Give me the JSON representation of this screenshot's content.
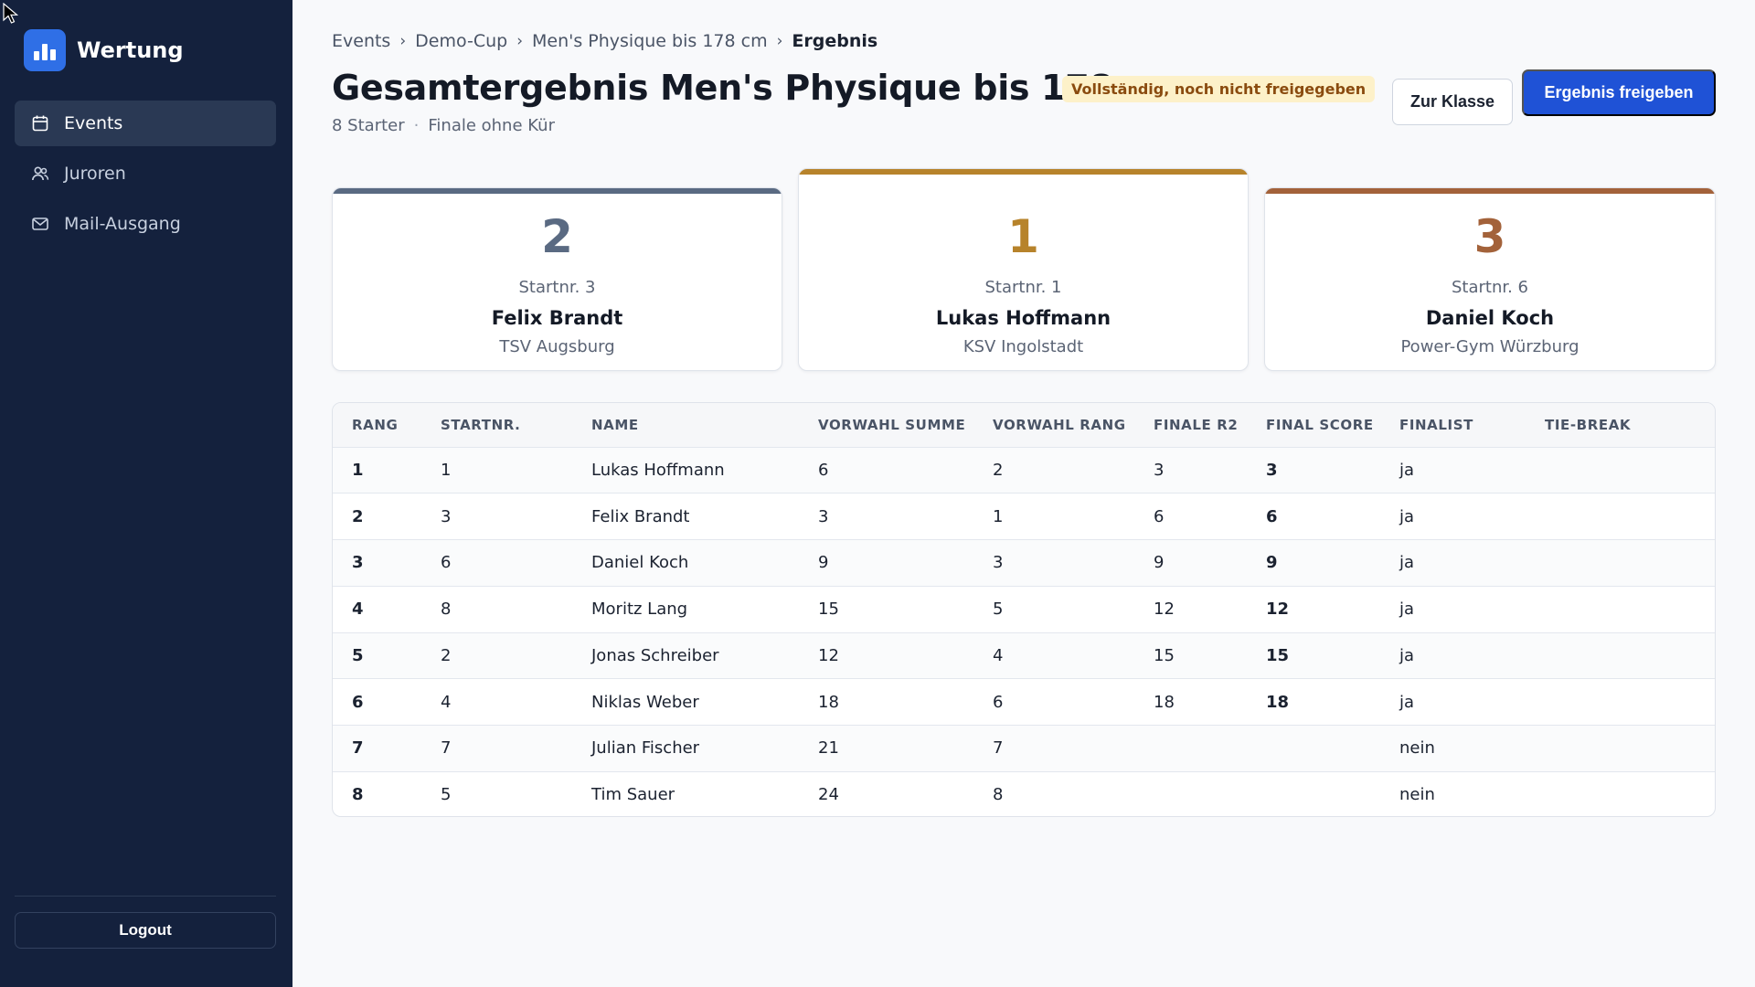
{
  "app": {
    "name": "Wertung",
    "logout_label": "Logout"
  },
  "sidebar": {
    "items": [
      {
        "label": "Events",
        "icon": "calendar-icon",
        "active": true
      },
      {
        "label": "Juroren",
        "icon": "users-icon",
        "active": false
      },
      {
        "label": "Mail-Ausgang",
        "icon": "mail-icon",
        "active": false
      }
    ]
  },
  "breadcrumb": {
    "items": [
      "Events",
      "Demo-Cup",
      "Men's Physique bis 178 cm"
    ],
    "current": "Ergebnis"
  },
  "header": {
    "title": "Gesamtergebnis Men's Physique bis 178 cm",
    "status_badge": "Vollständig, noch nicht freigegeben",
    "starter_count": "8 Starter",
    "mode": "Finale ohne Kür",
    "secondary_button": "Zur Klasse",
    "primary_button": "Ergebnis freigeben"
  },
  "podium": {
    "second": {
      "place": "2",
      "startnr": "Startnr. 3",
      "name": "Felix Brandt",
      "club": "TSV Augsburg",
      "color": "#5a6a82"
    },
    "first": {
      "place": "1",
      "startnr": "Startnr. 1",
      "name": "Lukas Hoffmann",
      "club": "KSV Ingolstadt",
      "color": "#b7832b"
    },
    "third": {
      "place": "3",
      "startnr": "Startnr. 6",
      "name": "Daniel Koch",
      "club": "Power-Gym Würzburg",
      "color": "#a3623a"
    }
  },
  "table": {
    "headers": [
      "RANG",
      "STARTNR.",
      "NAME",
      "VORWAHL SUMME",
      "VORWAHL RANG",
      "FINALE R2",
      "FINAL SCORE",
      "FINALIST",
      "TIE-BREAK"
    ],
    "rows": [
      [
        "1",
        "1",
        "Lukas Hoffmann",
        "6",
        "2",
        "3",
        "3",
        "ja",
        ""
      ],
      [
        "2",
        "3",
        "Felix Brandt",
        "3",
        "1",
        "6",
        "6",
        "ja",
        ""
      ],
      [
        "3",
        "6",
        "Daniel Koch",
        "9",
        "3",
        "9",
        "9",
        "ja",
        ""
      ],
      [
        "4",
        "8",
        "Moritz Lang",
        "15",
        "5",
        "12",
        "12",
        "ja",
        ""
      ],
      [
        "5",
        "2",
        "Jonas Schreiber",
        "12",
        "4",
        "15",
        "15",
        "ja",
        ""
      ],
      [
        "6",
        "4",
        "Niklas Weber",
        "18",
        "6",
        "18",
        "18",
        "ja",
        ""
      ],
      [
        "7",
        "7",
        "Julian Fischer",
        "21",
        "7",
        "",
        "",
        "nein",
        ""
      ],
      [
        "8",
        "5",
        "Tim Sauer",
        "24",
        "8",
        "",
        "",
        "nein",
        ""
      ]
    ]
  }
}
